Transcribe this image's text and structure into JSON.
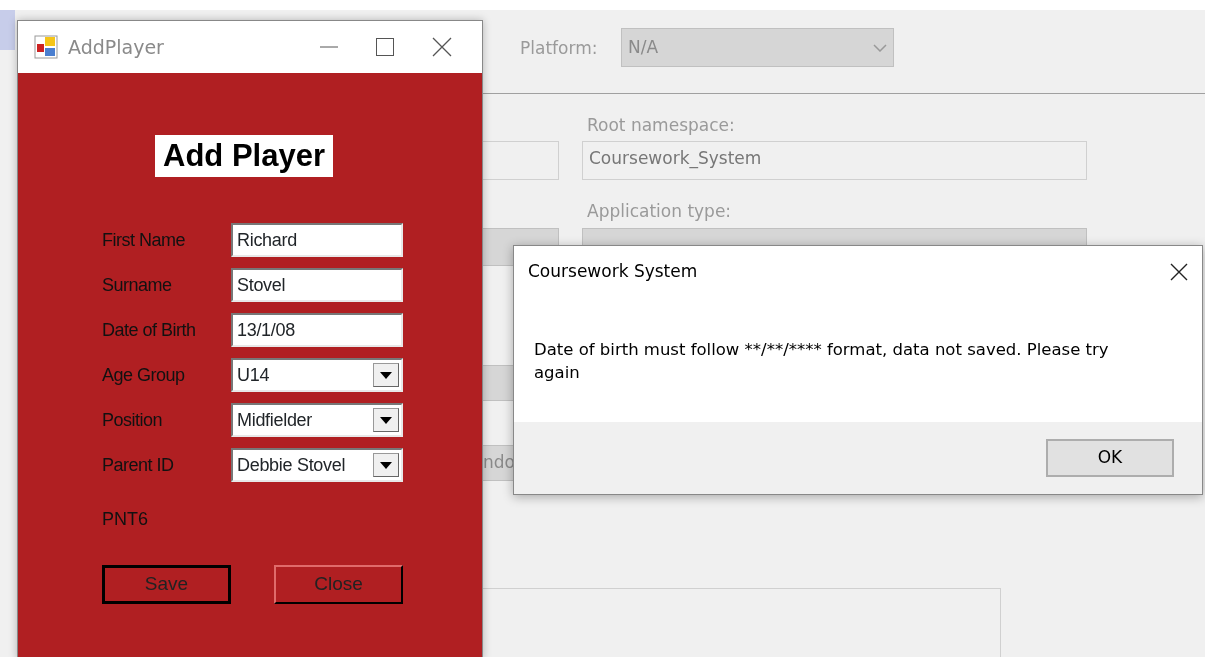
{
  "background_window": {
    "platform_label": "Platform:",
    "platform_value": "N/A",
    "root_namespace_label": "Root namespace:",
    "root_namespace_value": "Coursework_System",
    "application_type_label": "Application type:",
    "cut_text": "ndo"
  },
  "add_player_window": {
    "title": "AddPlayer",
    "heading": "Add Player",
    "fields": [
      {
        "kind": "text",
        "label": "First Name",
        "value": "Richard"
      },
      {
        "kind": "text",
        "label": "Surname",
        "value": "Stovel"
      },
      {
        "kind": "text",
        "label": "Date of Birth",
        "value": "13/1/08"
      },
      {
        "kind": "dropdown",
        "label": "Age Group",
        "value": "U14"
      },
      {
        "kind": "dropdown",
        "label": "Position",
        "value": "Midfielder"
      },
      {
        "kind": "dropdown",
        "label": "Parent ID",
        "value": "Debbie Stovel"
      }
    ],
    "parent_code": "PNT6",
    "buttons": [
      {
        "label": "Save",
        "focused": true
      },
      {
        "label": "Close",
        "focused": false
      }
    ]
  },
  "message_box": {
    "title": "Coursework System",
    "message": "Date of birth must follow **/**/**** format, data not saved. Please try again",
    "button": "OK"
  }
}
